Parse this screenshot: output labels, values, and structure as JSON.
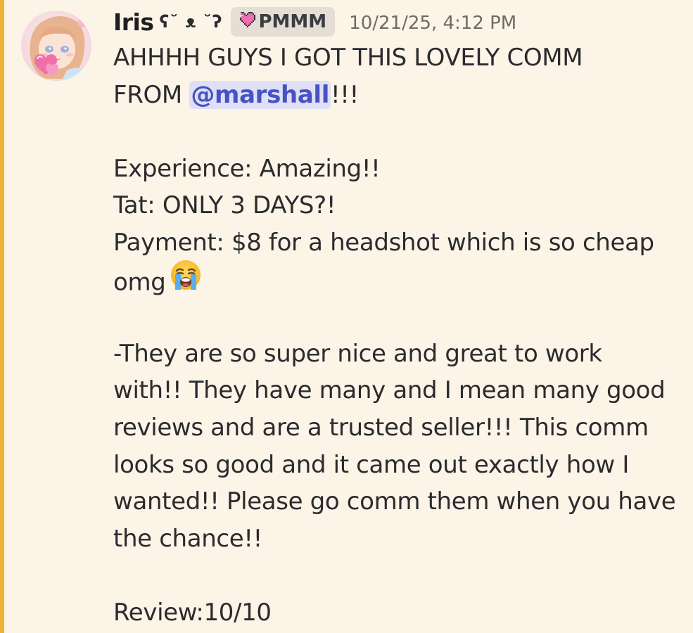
{
  "message": {
    "author": "Iris",
    "author_decoration": "ʕ˘ ᴥ ˘ʔ",
    "role_tag": "PMMM",
    "timestamp": "10/21/25, 4:12 PM",
    "line1": "AHHHH GUYS I GOT THIS LOVELY COMM",
    "line2_prefix": "FROM ",
    "mention": "@marshall",
    "line2_suffix": "!!!",
    "experience": "Experience: Amazing!!",
    "tat": "Tat: ONLY 3 DAYS?!",
    "payment_line1": "Payment: $8 for a headshot which is so cheap",
    "payment_line2": "omg",
    "emoji": "loudly-crying-face-emoji",
    "para1": "-They are so super nice and great to work",
    "para2": "with!! They have many and I mean many good",
    "para3": "reviews and are a trusted seller!!! This comm",
    "para4": "looks so good and it came out exactly how I",
    "para5": "wanted!! Please go comm them when you have",
    "para6": "the chance!!",
    "review": "Review:10/10"
  },
  "colors": {
    "background": "#fbf4e7",
    "mention_bar": "#f0b232",
    "mention_bg": "#dfe0f6",
    "mention_text": "#4752c4",
    "role_tag_bg": "#e4ded4",
    "role_heart": "#f06fb0"
  }
}
